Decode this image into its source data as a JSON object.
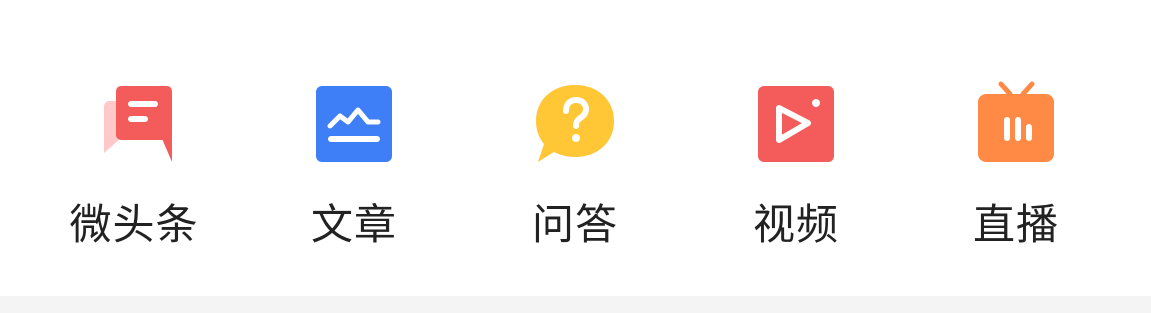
{
  "actions": [
    {
      "label": "微头条",
      "icon": "micro-post-icon",
      "color": "#f45b5b"
    },
    {
      "label": "文章",
      "icon": "article-icon",
      "color": "#3e7ef7"
    },
    {
      "label": "问答",
      "icon": "qa-icon",
      "color": "#ffc736"
    },
    {
      "label": "视频",
      "icon": "video-icon",
      "color": "#f45b5b"
    },
    {
      "label": "直播",
      "icon": "live-icon",
      "color": "#ff8a45"
    }
  ]
}
